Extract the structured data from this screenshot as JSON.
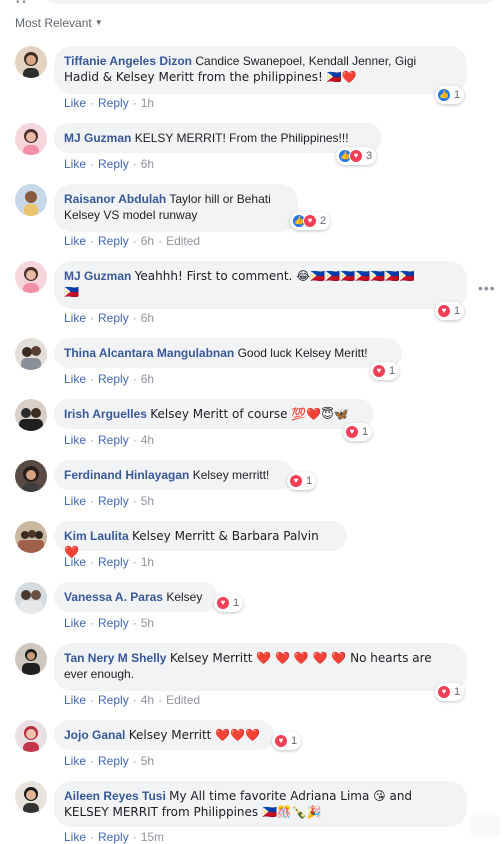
{
  "sort": {
    "label": "Most Relevant",
    "icon": "caret-down-icon"
  },
  "top_more": "• •",
  "comments": [
    {
      "author": "Tiffanie Angeles Dizon",
      "text": "Candice Swanepoel, Kendall Jenner, Gigi",
      "text2": "Hadid & Kelsey Meritt from the philippines! 🇵🇭❤️",
      "like": "Like",
      "reply": "Reply",
      "time": "1h",
      "edited": "",
      "reaction_count": "1",
      "reactions": [
        "like"
      ]
    },
    {
      "author": "MJ Guzman",
      "text": "KELSY MERRIT! From the Philippines!!!",
      "text2": "",
      "like": "Like",
      "reply": "Reply",
      "time": "6h",
      "edited": "",
      "reaction_count": "3",
      "reactions": [
        "like",
        "love"
      ]
    },
    {
      "author": "Raisanor Abdulah",
      "text": "Taylor hill or Behati",
      "text2": "Kelsey VS model runway",
      "like": "Like",
      "reply": "Reply",
      "time": "6h",
      "edited": "Edited",
      "reaction_count": "2",
      "reactions": [
        "like",
        "love"
      ]
    },
    {
      "author": "MJ Guzman",
      "text": "Yeahhh! First to comment. 😂🇵🇭🇵🇭🇵🇭🇵🇭🇵🇭🇵🇭🇵🇭",
      "text2": "🇵🇭",
      "like": "Like",
      "reply": "Reply",
      "time": "6h",
      "edited": "",
      "reaction_count": "1",
      "reactions": [
        "love"
      ]
    },
    {
      "author": "Thina Alcantara Mangulabnan",
      "text": "Good luck Kelsey Meritt!",
      "text2": "",
      "like": "Like",
      "reply": "Reply",
      "time": "6h",
      "edited": "",
      "reaction_count": "1",
      "reactions": [
        "love"
      ]
    },
    {
      "author": "Irish Arguelles",
      "text": "Kelsey Meritt of course 💯❤️😇🦋",
      "text2": "",
      "like": "Like",
      "reply": "Reply",
      "time": "4h",
      "edited": "",
      "reaction_count": "1",
      "reactions": [
        "love"
      ]
    },
    {
      "author": "Ferdinand Hinlayagan",
      "text": "Kelsey merritt!",
      "text2": "",
      "like": "Like",
      "reply": "Reply",
      "time": "5h",
      "edited": "",
      "reaction_count": "1",
      "reactions": [
        "love"
      ]
    },
    {
      "author": "Kim Laulita",
      "text": "Kelsey Merritt & Barbara Palvin ❤️",
      "text2": "",
      "like": "Like",
      "reply": "Reply",
      "time": "1h",
      "edited": "",
      "reaction_count": "",
      "reactions": []
    },
    {
      "author": "Vanessa A. Paras",
      "text": "Kelsey",
      "text2": "",
      "like": "Like",
      "reply": "Reply",
      "time": "5h",
      "edited": "",
      "reaction_count": "1",
      "reactions": [
        "love"
      ]
    },
    {
      "author": "Tan Nery M Shelly",
      "text": "Kelsey Merritt ❤️ ❤️ ❤️ ❤️ ❤️ No hearts are",
      "text2": "ever enough.",
      "like": "Like",
      "reply": "Reply",
      "time": "4h",
      "edited": "Edited",
      "reaction_count": "1",
      "reactions": [
        "love"
      ]
    },
    {
      "author": "Jojo Ganal",
      "text": "Kelsey Merritt ❤️❤️❤️",
      "text2": "",
      "like": "Like",
      "reply": "Reply",
      "time": "5h",
      "edited": "",
      "reaction_count": "1",
      "reactions": [
        "love"
      ]
    },
    {
      "author": "Aileen Reyes Tusi",
      "text": "My All time favorite Adriana Lima 😘 and",
      "text2": "KELSEY MERRIT from Philippines 🇵🇭🎊🍾🎉",
      "like": "Like",
      "reply": "Reply",
      "time": "15m",
      "edited": "",
      "reaction_count": "",
      "reactions": []
    }
  ],
  "more_menu": "•••",
  "colors": {
    "author": "#385898",
    "action": "#4267b2",
    "meta": "#90949c",
    "bubble": "#f2f3f5",
    "like": "#2078f4",
    "love": "#f33e58"
  }
}
